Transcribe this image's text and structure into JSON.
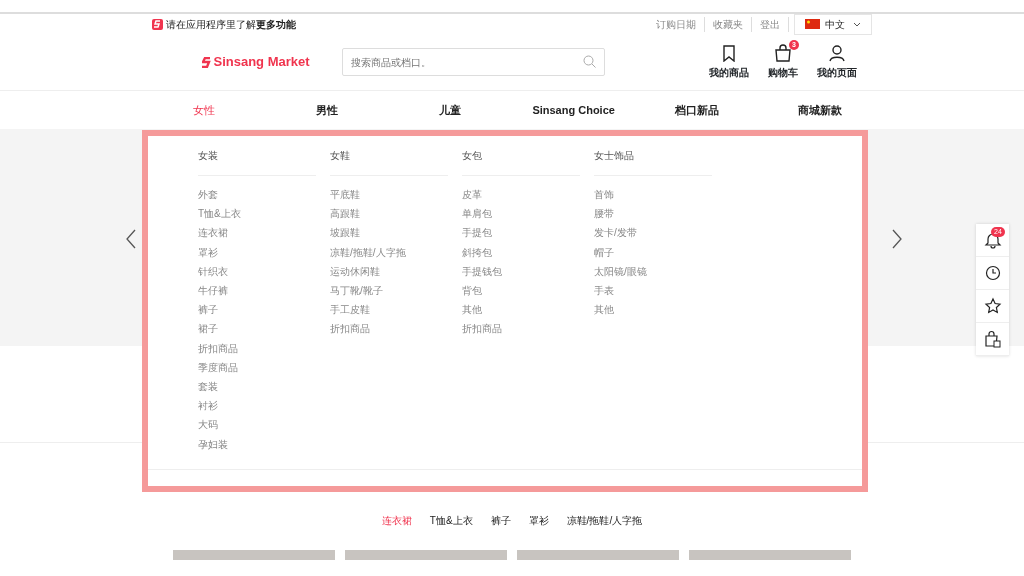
{
  "app_banner": {
    "text": "请在应用程序里了解**更多功能**"
  },
  "top_links": [
    "订购日期",
    "收藏夹",
    "登出"
  ],
  "language": {
    "label": "中文"
  },
  "logo": {
    "text": "Sinsang Market"
  },
  "search": {
    "placeholder": "搜索商品或档口。"
  },
  "header_actions": [
    {
      "kind": "bookmark",
      "label": "我的商品"
    },
    {
      "kind": "cart",
      "label": "购物车",
      "badge": "3"
    },
    {
      "kind": "user",
      "label": "我的页面"
    }
  ],
  "nav": [
    {
      "label": "女性",
      "selected": true
    },
    {
      "label": "男性",
      "selected": false
    },
    {
      "label": "儿童",
      "selected": false
    },
    {
      "label": "Sinsang Choice",
      "selected": false
    },
    {
      "label": "档口新品",
      "selected": false
    },
    {
      "label": "商城新款",
      "selected": false
    }
  ],
  "mega_menu": [
    {
      "title": "女装",
      "items": [
        "外套",
        "T恤&上衣",
        "连衣裙",
        "罩衫",
        "针织衣",
        "牛仔裤",
        "裤子",
        "裙子",
        "折扣商品",
        "季度商品",
        "套装",
        "衬衫",
        "大码",
        "孕妇装"
      ]
    },
    {
      "title": "女鞋",
      "items": [
        "平底鞋",
        "高跟鞋",
        "坡跟鞋",
        "凉鞋/拖鞋/人字拖",
        "运动休闲鞋",
        "马丁靴/靴子",
        "手工皮鞋",
        "折扣商品"
      ]
    },
    {
      "title": "女包",
      "items": [
        "皮革",
        "单肩包",
        "手提包",
        "斜挎包",
        "手提钱包",
        "背包",
        "其他",
        "折扣商品"
      ]
    },
    {
      "title": "女士饰品",
      "items": [
        "首饰",
        "腰带",
        "发卡/发带",
        "帽子",
        "太阳镜/眼镜",
        "手表",
        "其他"
      ]
    }
  ],
  "best_tabs": [
    {
      "label": "连衣裙",
      "selected": true
    },
    {
      "label": "T恤&上衣",
      "selected": false
    },
    {
      "label": "裤子",
      "selected": false
    },
    {
      "label": "罩衫",
      "selected": false
    },
    {
      "label": "凉鞋/拖鞋/人字拖",
      "selected": false
    }
  ],
  "side_tools": [
    {
      "kind": "bell",
      "badge": "24"
    },
    {
      "kind": "clock"
    },
    {
      "kind": "star"
    },
    {
      "kind": "bag"
    }
  ]
}
